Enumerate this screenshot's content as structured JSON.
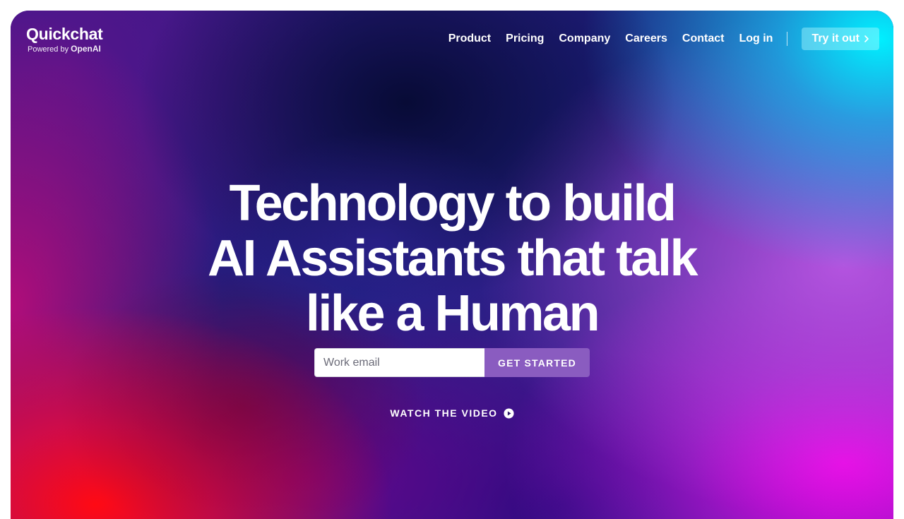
{
  "brand": {
    "name": "Quickchat",
    "powered_prefix": "Powered by",
    "powered_brand": "OpenAI"
  },
  "nav": {
    "items": [
      {
        "label": "Product"
      },
      {
        "label": "Pricing"
      },
      {
        "label": "Company"
      },
      {
        "label": "Careers"
      },
      {
        "label": "Contact"
      },
      {
        "label": "Log in"
      }
    ],
    "cta_label": "Try it out",
    "cta_icon": "chevron-right-icon"
  },
  "hero": {
    "title_lines": [
      "Technology to build",
      "AI Assistants that talk",
      "like a Human"
    ]
  },
  "signup": {
    "email_placeholder": "Work email",
    "email_value": "",
    "button_label": "GET STARTED"
  },
  "video": {
    "label": "WATCH THE VIDEO",
    "icon": "play-circle-icon"
  },
  "colors": {
    "text": "#ffffff",
    "cta_button": "#8a5cc0",
    "top_right_glow": "#00f0ff",
    "bottom_left_glow": "#ff0a14",
    "bottom_right_glow": "#f000e6"
  }
}
